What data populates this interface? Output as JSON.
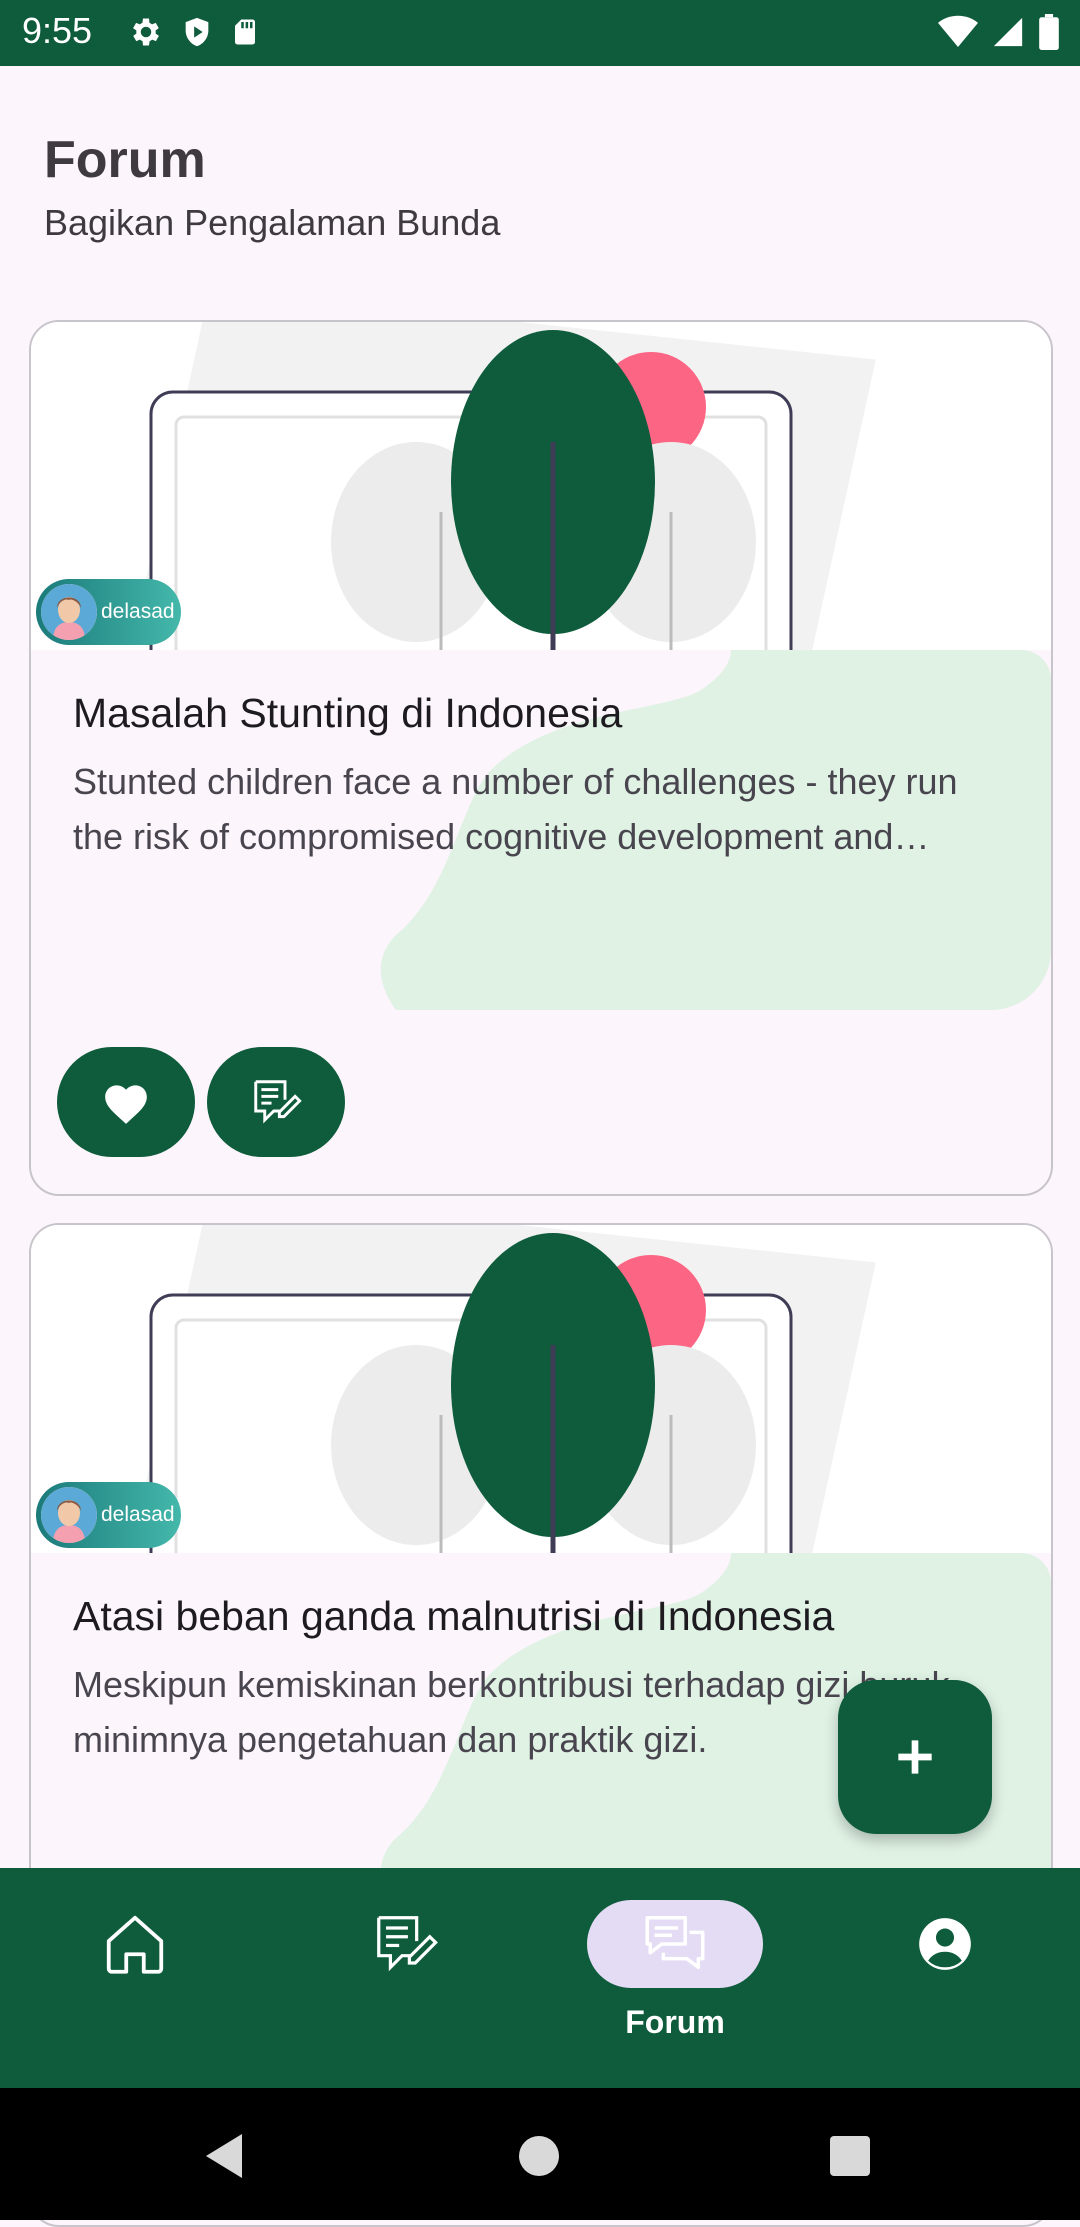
{
  "status_bar": {
    "time": "9:55",
    "left_icons": [
      "gear-icon",
      "play-protect-icon",
      "sd-card-icon"
    ],
    "right_icons": [
      "wifi-icon",
      "signal-icon",
      "battery-icon"
    ]
  },
  "header": {
    "title": "Forum",
    "subtitle": "Bagikan Pengalaman Bunda"
  },
  "posts": [
    {
      "author": "delasad",
      "title": "Masalah Stunting di Indonesia",
      "excerpt": "Stunted children face a number of challenges - they run the risk of compromised cognitive development and physical capacity",
      "actions": [
        "heart-icon",
        "comment-icon"
      ]
    },
    {
      "author": "delasad",
      "title": "Atasi beban ganda malnutrisi di Indonesia",
      "excerpt": "Meskipun kemiskinan berkontribusi terhadap gizi buruk, minimnya pengetahuan dan praktik gizi."
    }
  ],
  "fab": {
    "icon": "plus-icon"
  },
  "bottom_nav": {
    "items": [
      {
        "icon": "home-icon",
        "label": ""
      },
      {
        "icon": "article-edit-icon",
        "label": ""
      },
      {
        "icon": "forum-icon",
        "label": "Forum",
        "active": true
      },
      {
        "icon": "account-icon",
        "label": ""
      }
    ]
  },
  "system_nav": [
    "back-icon",
    "home-circle-icon",
    "recents-icon"
  ],
  "colors": {
    "primary": "#0e5c3c",
    "background": "#fcf5fc",
    "accent_blob": "#dff2e4",
    "active_pill": "#e4dcf4",
    "illustration_pink": "#fd6584"
  }
}
